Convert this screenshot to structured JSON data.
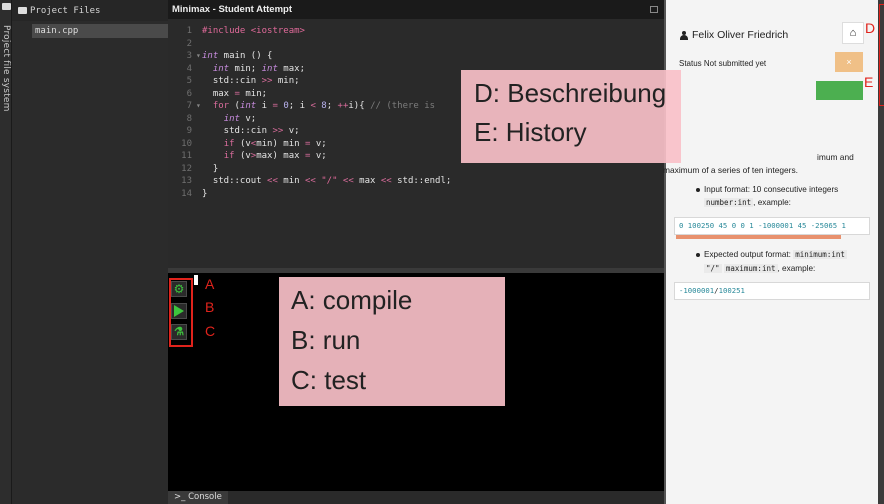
{
  "sidebar": {
    "vertical_label": "Project file system"
  },
  "file_panel": {
    "header": "Project Files",
    "files": [
      {
        "name": "main.cpp",
        "icon": "gears-icon"
      }
    ]
  },
  "editor": {
    "title": "Minimax - Student Attempt",
    "line_numbers": [
      "1",
      "2",
      "3",
      "4",
      "5",
      "6",
      "7",
      "8",
      "9",
      "10",
      "11",
      "12",
      "13",
      "14"
    ]
  },
  "toolbar": {
    "compile_icon": "gears-icon",
    "run_icon": "play-icon",
    "test_icon": "flask-icon",
    "label_a": "A",
    "label_b": "B",
    "label_c": "C"
  },
  "console": {
    "tab_label": ">_ Console"
  },
  "right_panel": {
    "user_name": "Felix Oliver Friedrich",
    "status_text": "Status Not submitted yet",
    "close_label": "×",
    "label_d": "D",
    "label_e": "E",
    "description_line1": "imum and",
    "description_line2": "maximum of a series of ten integers.",
    "input_format_text": "Input format: 10 consecutive integers",
    "input_format_code": "number:int",
    "input_format_suffix": ", example:",
    "input_example": "0 100250 45 0 0 1 -1000001 45 -25065 1",
    "output_format_text": "Expected output format:",
    "output_format_code1": "minimum:int",
    "output_format_code2": "\"/\"",
    "output_format_code3": "maximum:int",
    "output_format_suffix": ", example:",
    "output_example_a": "-1000001",
    "output_example_sep": "/",
    "output_example_b": "100251"
  },
  "overlays": {
    "top": {
      "line1": "D: Beschreibung",
      "line2": "E: History"
    },
    "bottom": {
      "line1": "A: compile",
      "line2": "B: run",
      "line3": "C: test"
    }
  },
  "colors": {
    "accent_green": "#3dc43d",
    "annotation_red": "#e0231c",
    "overlay_pink": "#f8c0c8",
    "status_green": "#4caf50",
    "close_orange": "#f0c087"
  }
}
